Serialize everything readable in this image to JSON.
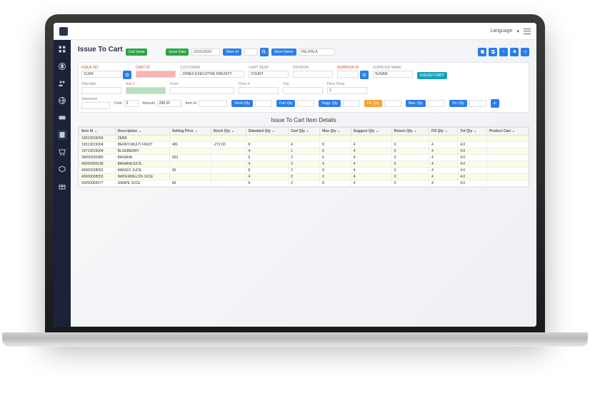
{
  "topbar": {
    "language_label": "Language"
  },
  "page": {
    "title": "Issue To Cart"
  },
  "toolbar": {
    "cart_issue": "Cart Issue",
    "issue_date_label": "Issue Date",
    "issue_date_value": "02/01/2020",
    "store_id_label": "Store Id",
    "store_name_label": "Store Name",
    "store_name_value": "PELIPALA"
  },
  "form": {
    "issue_no": {
      "label": "ISSUE NO",
      "value": "11304"
    },
    "cart_id": {
      "label": "CART ID"
    },
    "customer": {
      "label": "CUSTOMER",
      "value": "JONES EXECUTIVE INDUSTY"
    },
    "cart_desp": {
      "label": "CART DESP",
      "value": "COUNT"
    },
    "division": {
      "label": "DIVISION"
    },
    "supervisor": {
      "label": "SUPRVSR ID"
    },
    "supervisor_name": {
      "label": "SUPRVSR NAME",
      "value": "SUSAN"
    },
    "ship_add": {
      "label": "Ship Add"
    },
    "add_1": {
      "label": "Add 1"
    },
    "from": {
      "label": "From"
    },
    "floor": {
      "label": "Floor #"
    },
    "city": {
      "label": "City"
    },
    "floor_desp": {
      "label": "Floor Desp",
      "value": "1"
    },
    "salesman": {
      "label": "Salesman"
    },
    "cont": {
      "label": "Cont",
      "value": "0"
    },
    "amount": {
      "label": "Amount",
      "value": "289.20"
    },
    "item_id": {
      "label": "Item Id"
    }
  },
  "qtylabels": {
    "stock_qty": "Stock Qty",
    "cart_qty": "Cart Qty",
    "sugg_qty": "Sugg. Qty",
    "fill_qty": "Fill. Qty",
    "max_qty": "Max. Qty",
    "tot_qty": "Tot. Qty"
  },
  "buttons": {
    "issued_cart": "ISSUED CART"
  },
  "details": {
    "title": "Issue To Cart Item Details"
  },
  "columns": [
    "Item Id",
    "Description",
    "Selling Price",
    "Stock Qty",
    "Standard Qty",
    "Cart Qty",
    "Max Qty",
    "Suggest Qty",
    "Return Qty",
    "Fill Qty",
    "Tot Qty",
    "Product Cart"
  ],
  "rows": [
    {
      "id": "10013015004",
      "desc": "ZEBA",
      "sp": "",
      "stk": "",
      "std": "",
      "cart": "",
      "max": "",
      "sug": "",
      "ret": "",
      "fill": "",
      "tot": "",
      "pc": ""
    },
    {
      "id": "10013015004",
      "desc": "BERRY-MULTI FRUIT",
      "sp": "481",
      "stk": "-271.50",
      "std": "8",
      "cart": "4",
      "max": "8",
      "sug": "4",
      "ret": "0",
      "fill": "4",
      "tot": "4.0",
      "pc": ""
    },
    {
      "id": "19713015004",
      "desc": "BLUEBERRY",
      "sp": "",
      "stk": "",
      "std": "4",
      "cart": "1",
      "max": "6",
      "sug": "4",
      "ret": "0",
      "fill": "4",
      "tot": "4.0",
      "pc": ""
    },
    {
      "id": "39000030480",
      "desc": "BANANA",
      "sp": "063",
      "stk": "",
      "std": "6",
      "cart": "2",
      "max": "6",
      "sug": "4",
      "ret": "0",
      "fill": "4",
      "tot": "4.0",
      "pc": ""
    },
    {
      "id": "49000000148",
      "desc": "BANANAJUCE",
      "sp": "",
      "stk": "",
      "std": "4",
      "cart": "0",
      "max": "4",
      "sug": "4",
      "ret": "0",
      "fill": "4",
      "tot": "4.0",
      "pc": ""
    },
    {
      "id": "49900028052",
      "desc": "MANGO JUCE",
      "sp": "90",
      "stk": "",
      "std": "8",
      "cart": "2",
      "max": "8",
      "sug": "4",
      "ret": "0",
      "fill": "4",
      "tot": "4.0",
      "pc": ""
    },
    {
      "id": "49900028053",
      "desc": "WATERMELON JUCE",
      "sp": "",
      "stk": "",
      "std": "4",
      "cart": "0",
      "max": "6",
      "sug": "4",
      "ret": "0",
      "fill": "4",
      "tot": "4.0",
      "pc": ""
    },
    {
      "id": "50050060077",
      "desc": "GRAPE JUCE",
      "sp": "86",
      "stk": "",
      "std": "8",
      "cart": "2",
      "max": "8",
      "sug": "4",
      "ret": "0",
      "fill": "4",
      "tot": "4.0",
      "pc": ""
    }
  ]
}
